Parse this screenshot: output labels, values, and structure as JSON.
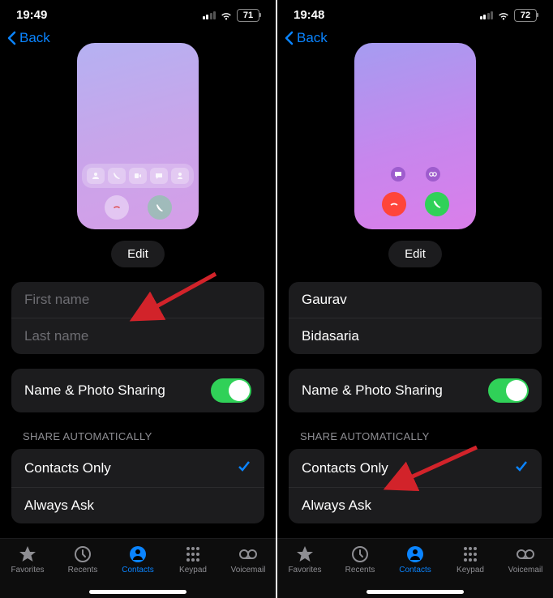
{
  "left": {
    "time": "19:49",
    "battery": "71",
    "back_label": "Back",
    "edit_label": "Edit",
    "first_name_placeholder": "First name",
    "last_name_placeholder": "Last name",
    "first_name_value": "",
    "last_name_value": "",
    "sharing_label": "Name & Photo Sharing",
    "section_label": "SHARE AUTOMATICALLY",
    "option_contacts": "Contacts Only",
    "option_always": "Always Ask"
  },
  "right": {
    "time": "19:48",
    "battery": "72",
    "back_label": "Back",
    "edit_label": "Edit",
    "first_name_value": "Gaurav",
    "last_name_value": "Bidasaria",
    "sharing_label": "Name & Photo Sharing",
    "section_label": "SHARE AUTOMATICALLY",
    "option_contacts": "Contacts Only",
    "option_always": "Always Ask"
  },
  "tabs": {
    "favorites": "Favorites",
    "recents": "Recents",
    "contacts": "Contacts",
    "keypad": "Keypad",
    "voicemail": "Voicemail"
  },
  "colors": {
    "accent": "#0a84ff",
    "toggle_on": "#30d158",
    "danger": "#ff453a",
    "arrow": "#d2232a"
  }
}
